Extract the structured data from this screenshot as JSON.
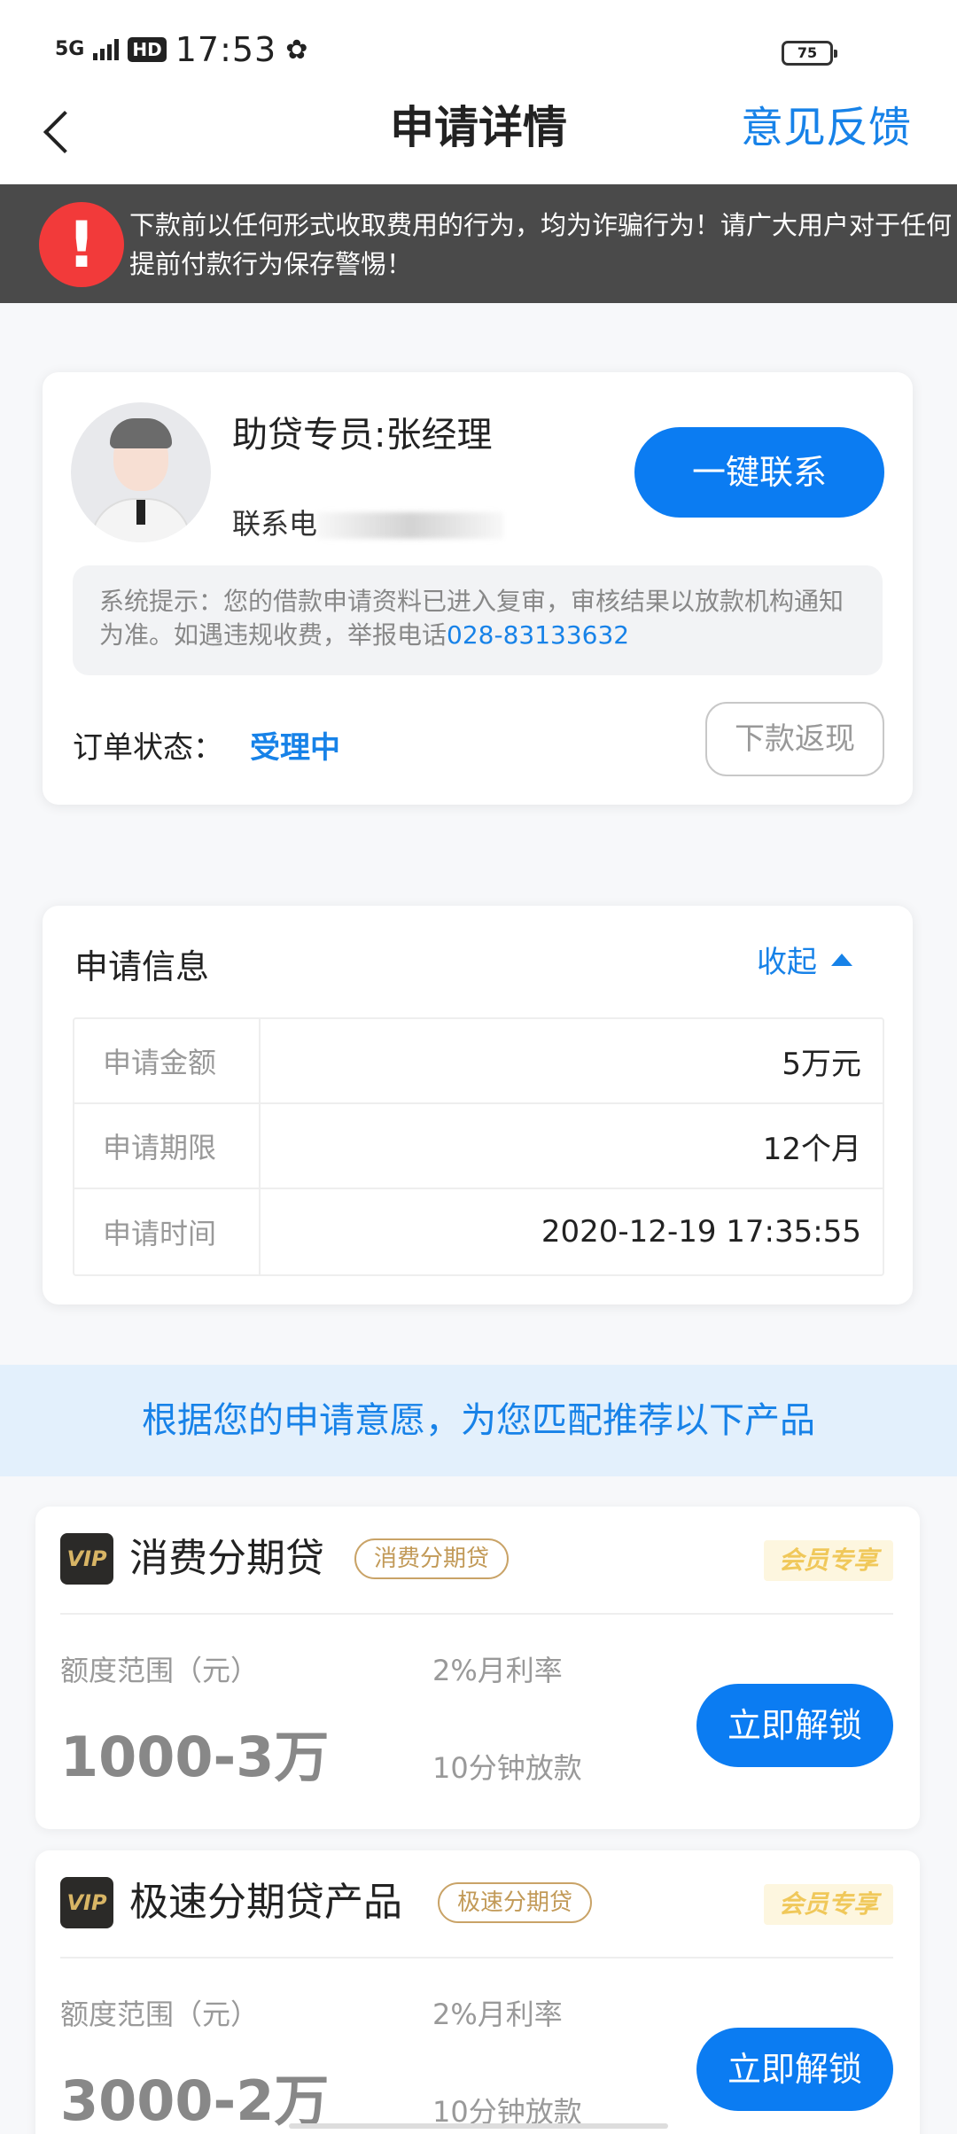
{
  "status_bar": {
    "network": "5G",
    "hd": "HD",
    "time": "17:53",
    "battery": "75"
  },
  "nav": {
    "title": "申请详情",
    "feedback": "意见反馈"
  },
  "warning": {
    "icon": "!",
    "text": "下款前以任何形式收取费用的行为，均为诈骗行为！请广大用户对于任何提前付款行为保存警惕！"
  },
  "agent": {
    "name": "助贷专员:张经理",
    "phone_prefix": "联系电",
    "contact_button": "一键联系",
    "tip_text": "系统提示：您的借款申请资料已进入复审，审核结果以放款机构通知为准。如遇违规收费，举报电话",
    "tip_phone": "028-83133632",
    "order_label": "订单状态：",
    "order_status": "受理中",
    "cashback_button": "下款返现"
  },
  "application": {
    "title": "申请信息",
    "collapse": "收起",
    "rows": [
      {
        "key": "申请金额",
        "value": "5万元"
      },
      {
        "key": "申请期限",
        "value": "12个月"
      },
      {
        "key": "申请时间",
        "value": "2020-12-19 17:35:55"
      }
    ]
  },
  "recommend": {
    "banner": "根据您的申请意愿，为您匹配推荐以下产品"
  },
  "products": [
    {
      "vip": "VIP",
      "name": "消费分期贷",
      "tag": "消费分期贷",
      "member": "会员专享",
      "range_label": "额度范围（元）",
      "range": "1000-3万",
      "rate": "2%月利率",
      "speed": "10分钟放款",
      "button": "立即解锁"
    },
    {
      "vip": "VIP",
      "name": "极速分期贷产品",
      "tag": "极速分期贷",
      "member": "会员专享",
      "range_label": "额度范围（元）",
      "range": "3000-2万",
      "rate": "2%月利率",
      "speed": "10分钟放款",
      "button": "立即解锁"
    }
  ],
  "colors": {
    "accent": "#0b7cf2",
    "link": "#1782e8",
    "warning_bg": "#4a4a4a",
    "alert_red": "#f23a3a",
    "banner_bg": "#e3f0fc"
  }
}
